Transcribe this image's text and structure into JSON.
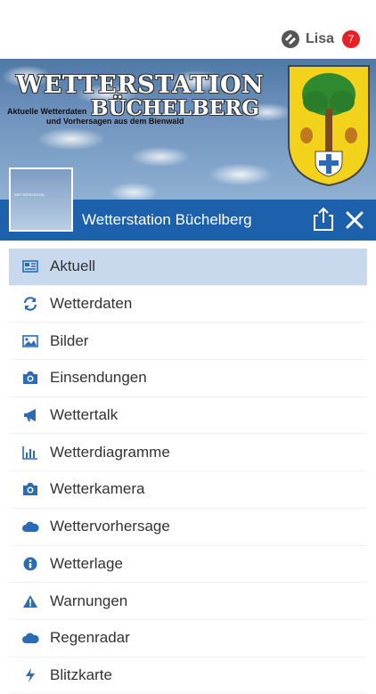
{
  "header": {
    "user_name": "Lisa",
    "badge_count": "7"
  },
  "banner": {
    "title_line1": "WETTERSTATION",
    "title_line2": "BÜCHELBERG",
    "subtitle_line1": "Aktuelle Wetterdaten",
    "subtitle_line2": "und Vorhersagen aus dem Bienwald"
  },
  "titlebar": {
    "title": "Wetterstation Büchelberg"
  },
  "menu": {
    "items": [
      {
        "label": "Aktuell",
        "icon": "newspaper-icon",
        "active": true
      },
      {
        "label": "Wetterdaten",
        "icon": "refresh-icon"
      },
      {
        "label": "Bilder",
        "icon": "image-icon"
      },
      {
        "label": "Einsendungen",
        "icon": "camera-icon"
      },
      {
        "label": "Wettertalk",
        "icon": "megaphone-icon"
      },
      {
        "label": "Wetterdiagramme",
        "icon": "bar-chart-icon"
      },
      {
        "label": "Wetterkamera",
        "icon": "camera-icon"
      },
      {
        "label": "Wettervorhersage",
        "icon": "cloud-icon"
      },
      {
        "label": "Wetterlage",
        "icon": "info-icon"
      },
      {
        "label": "Warnungen",
        "icon": "warning-icon"
      },
      {
        "label": "Regenradar",
        "icon": "cloud-icon"
      },
      {
        "label": "Blitzkarte",
        "icon": "lightning-icon"
      }
    ]
  },
  "colors": {
    "titlebar_bg": "#1d61ad",
    "active_item_bg": "#c8d9ee",
    "icon_blue": "#2d6bb5",
    "badge_red": "#e52125"
  }
}
